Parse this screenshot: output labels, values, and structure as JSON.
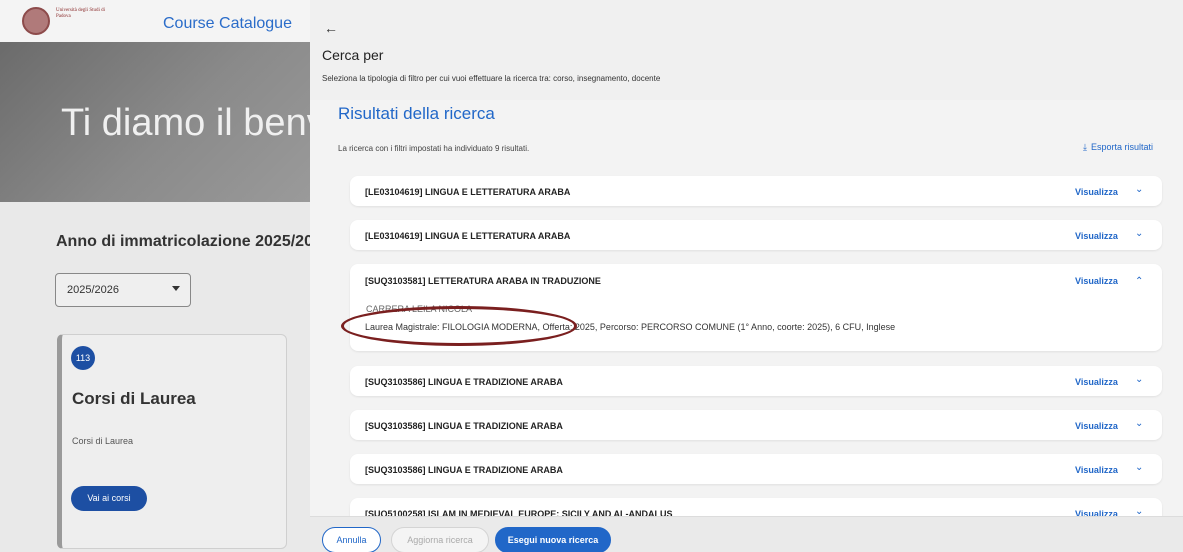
{
  "background": {
    "logo_text": "Università degli Studi di Padova",
    "catalogue_title": "Course Catalogue",
    "hero_text": "Ti diamo il benv",
    "year_heading": "Anno di immatricolazione 2025/20:",
    "year_select_value": "2025/2026",
    "card": {
      "count": "113",
      "title": "Corsi di Laurea",
      "subtitle": "Corsi di Laurea",
      "button": "Vai ai corsi"
    }
  },
  "panel": {
    "back": "←",
    "title": "Cerca per",
    "description": "Seleziona la tipologia di filtro per cui vuoi effettuare la ricerca tra: corso, insegnamento, docente",
    "results_title": "Risultati della ricerca",
    "results_desc": "La ricerca con i filtri impostati ha individuato 9 risultati.",
    "export_label": "Esporta risultati",
    "export_icon": "⤓",
    "rows": [
      {
        "title": "[LE03104619] LINGUA E LETTERATURA ARABA",
        "link": "Visualizza",
        "chevron": "⌄"
      },
      {
        "title": "[LE03104619] LINGUA E LETTERATURA ARABA",
        "link": "Visualizza",
        "chevron": "⌄"
      },
      {
        "title": "[SUQ3103581] LETTERATURA ARABA IN TRADUZIONE",
        "link": "Visualizza",
        "chevron": "⌃",
        "detail_name": "CARRERA LEILA NICOLA",
        "detail": "Laurea Magistrale: FILOLOGIA MODERNA, Offerta: 2025, Percorso: PERCORSO COMUNE (1° Anno, coorte: 2025), 6 CFU, Inglese"
      },
      {
        "title": "[SUQ3103586] LINGUA E TRADIZIONE ARABA",
        "link": "Visualizza",
        "chevron": "⌄"
      },
      {
        "title": "[SUQ3103586] LINGUA E TRADIZIONE ARABA",
        "link": "Visualizza",
        "chevron": "⌄"
      },
      {
        "title": "[SUQ3103586] LINGUA E TRADIZIONE ARABA",
        "link": "Visualizza",
        "chevron": "⌄"
      },
      {
        "title": "[SUQ5100258] ISLAM IN MEDIEVAL EUROPE: SICILY AND AL-ANDALUS",
        "link": "Visualizza",
        "chevron": "⌄"
      }
    ],
    "footer": {
      "annulla": "Annulla",
      "aggiorna": "Aggiorna ricerca",
      "esegui": "Esegui nuova ricerca"
    }
  },
  "colors": {
    "accent": "#2167c8",
    "brand_dark": "#1d4fa3",
    "annotation": "#7a1f1f"
  }
}
